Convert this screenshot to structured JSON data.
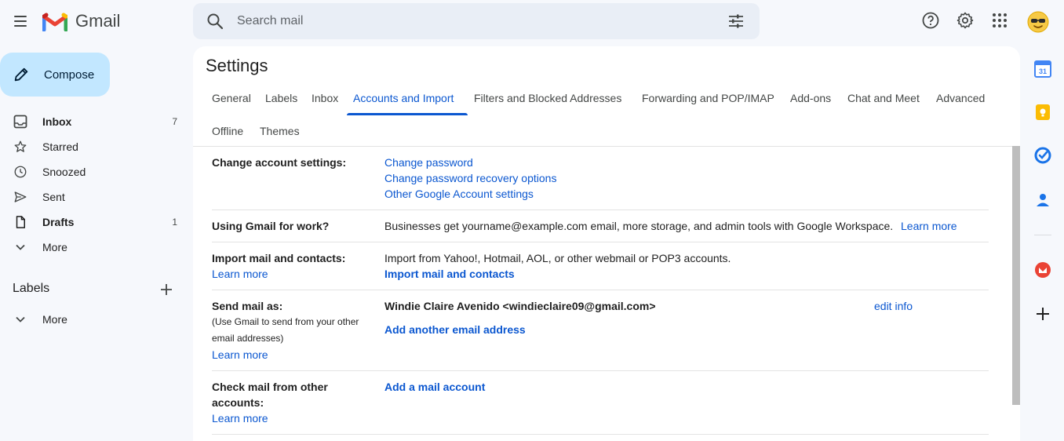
{
  "header": {
    "brand": "Gmail",
    "search_placeholder": "Search mail"
  },
  "nav": {
    "compose": "Compose",
    "items": [
      {
        "label": "Inbox",
        "count": "7"
      },
      {
        "label": "Starred",
        "count": ""
      },
      {
        "label": "Snoozed",
        "count": ""
      },
      {
        "label": "Sent",
        "count": ""
      },
      {
        "label": "Drafts",
        "count": "1"
      },
      {
        "label": "More",
        "count": ""
      }
    ],
    "labels_title": "Labels",
    "labels_more": "More"
  },
  "settings": {
    "title": "Settings",
    "tabs": [
      "General",
      "Labels",
      "Inbox",
      "Accounts and Import",
      "Filters and Blocked Addresses",
      "Forwarding and POP/IMAP",
      "Add-ons",
      "Chat and Meet",
      "Advanced",
      "Offline",
      "Themes"
    ],
    "active_tab": "Accounts and Import",
    "rows": {
      "change_account": {
        "label": "Change account settings:",
        "links": [
          "Change password",
          "Change password recovery options",
          "Other Google Account settings"
        ]
      },
      "gmail_work": {
        "label": "Using Gmail for work?",
        "text": "Businesses get yourname@example.com email, more storage, and admin tools with Google Workspace.",
        "link": "Learn more"
      },
      "import_mail": {
        "label": "Import mail and contacts:",
        "learn_more": "Learn more",
        "text": "Import from Yahoo!, Hotmail, AOL, or other webmail or POP3 accounts.",
        "action": "Import mail and contacts"
      },
      "send_mail_as": {
        "label": "Send mail as:",
        "sub1": "(Use Gmail to send from your other",
        "sub2": "email addresses)",
        "learn_more": "Learn more",
        "identity": "Windie Claire Avenido <windieclaire09@gmail.com>",
        "edit": "edit info",
        "action": "Add another email address"
      },
      "check_mail": {
        "label1": "Check mail from other",
        "label2": "accounts:",
        "learn_more": "Learn more",
        "action": "Add a mail account"
      }
    }
  },
  "colors": {
    "accent": "#0b57d0",
    "compose_bg": "#c2e7ff",
    "page_bg": "#f6f8fc"
  }
}
